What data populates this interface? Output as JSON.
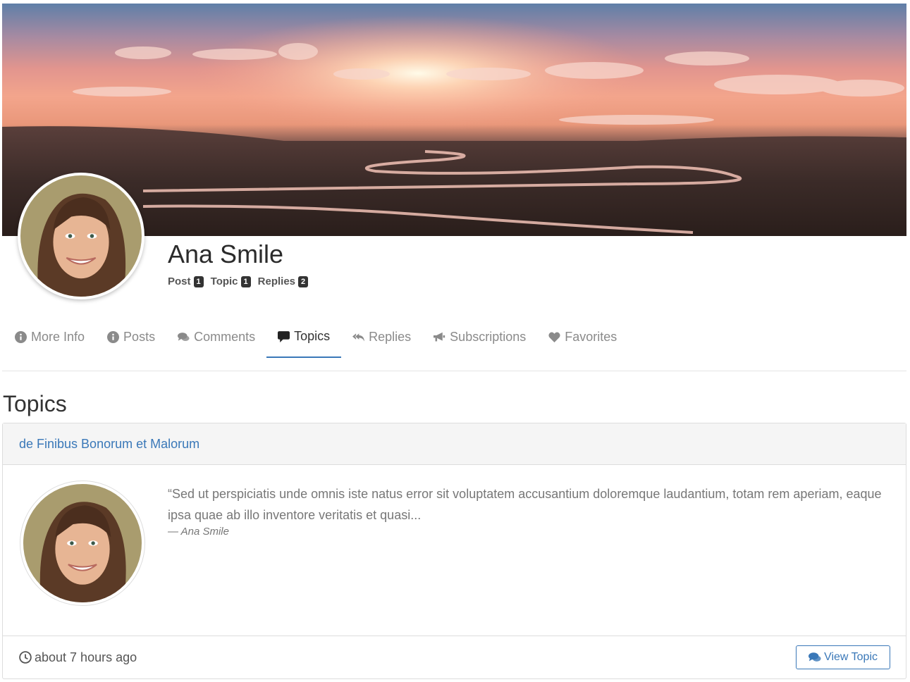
{
  "profile": {
    "name": "Ana Smile",
    "stats": [
      {
        "label": "Post",
        "count": "1"
      },
      {
        "label": "Topic",
        "count": "1"
      },
      {
        "label": "Replies",
        "count": "2"
      }
    ]
  },
  "tabs": [
    {
      "label": "More Info",
      "icon": "info-circle-icon"
    },
    {
      "label": "Posts",
      "icon": "info-circle-icon"
    },
    {
      "label": "Comments",
      "icon": "comments-icon"
    },
    {
      "label": "Topics",
      "icon": "comment-icon",
      "active": true
    },
    {
      "label": "Replies",
      "icon": "reply-all-icon"
    },
    {
      "label": "Subscriptions",
      "icon": "bullhorn-icon"
    },
    {
      "label": "Favorites",
      "icon": "heart-icon"
    }
  ],
  "section": {
    "title": "Topics"
  },
  "topic": {
    "title": "de Finibus Bonorum et Malorum",
    "excerpt": "“Sed ut perspiciatis unde omnis iste natus error sit voluptatem accusantium doloremque laudantium, totam rem aperiam, eaque ipsa quae ab illo inventore veritatis et quasi...",
    "author": "— Ana Smile",
    "time": "about 7 hours ago",
    "button_label": "View Topic"
  },
  "colors": {
    "accent": "#3a78b8",
    "badge": "#333333"
  }
}
